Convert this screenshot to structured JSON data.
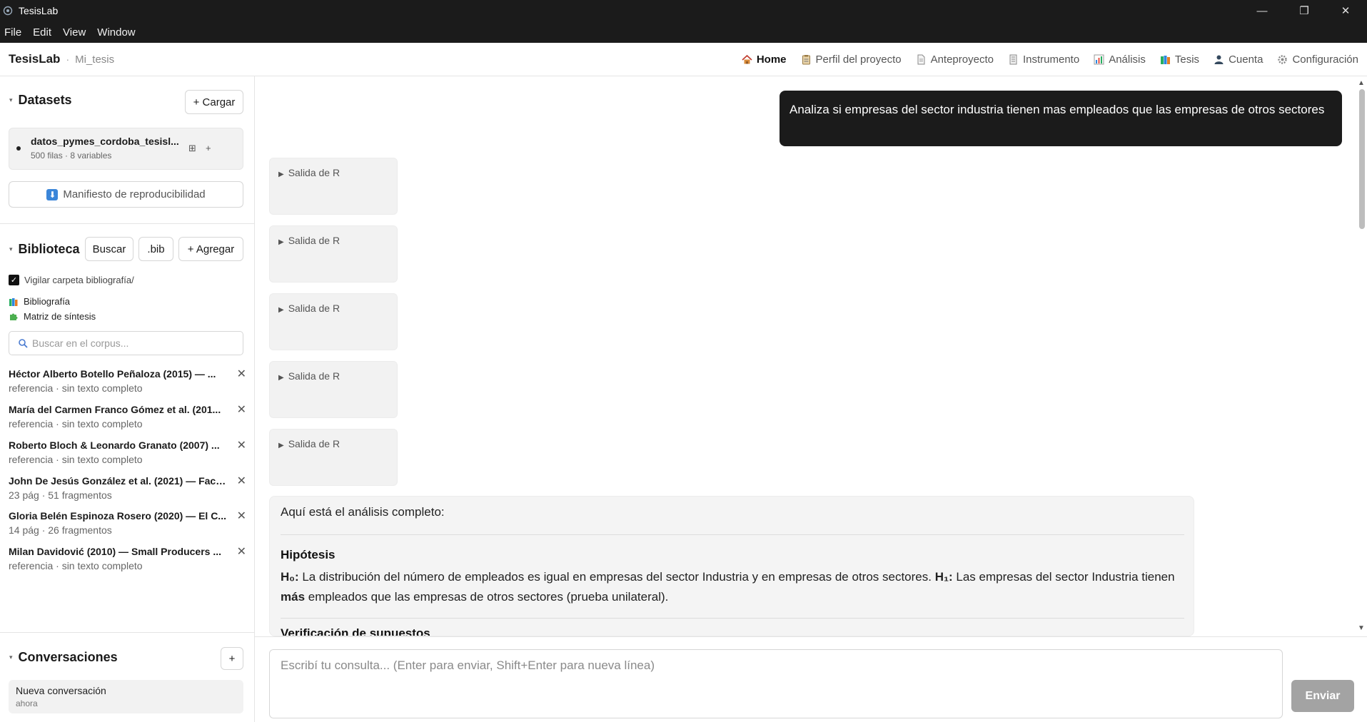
{
  "window": {
    "title": "TesisLab",
    "controls": {
      "minimize": "—",
      "maximize": "❐",
      "close": "✕"
    }
  },
  "menubar": {
    "items": [
      "File",
      "Edit",
      "View",
      "Window"
    ]
  },
  "header": {
    "brand": "TesisLab",
    "separator": "·",
    "project": "Mi_tesis",
    "nav": [
      {
        "label": "Home",
        "icon": "house-icon",
        "active": true
      },
      {
        "label": "Perfil del proyecto",
        "icon": "clipboard-icon"
      },
      {
        "label": "Anteproyecto",
        "icon": "document-icon"
      },
      {
        "label": "Instrumento",
        "icon": "list-icon"
      },
      {
        "label": "Análisis",
        "icon": "bar-chart-icon"
      },
      {
        "label": "Tesis",
        "icon": "books-icon"
      },
      {
        "label": "Cuenta",
        "icon": "user-icon"
      },
      {
        "label": "Configuración",
        "icon": "gear-icon"
      }
    ]
  },
  "sidebar": {
    "datasets": {
      "title": "Datasets",
      "caret": "▾",
      "load_button": "+ Cargar",
      "item": {
        "name": "datos_pymes_cordoba_tesisl...",
        "meta": "500 filas · 8 variables",
        "icon1": "⊞",
        "icon2": "+"
      },
      "manifest_button": "Manifiesto de reproducibilidad",
      "manifest_icon": "⬇"
    },
    "biblioteca": {
      "title": "Biblioteca",
      "caret": "▾",
      "buttons": {
        "search": "Buscar",
        "bib": ".bib",
        "add": "+ Agregar"
      },
      "watch_checkbox": {
        "label": "Vigilar carpeta bibliografía/",
        "checked": true
      },
      "links": [
        {
          "label": "Bibliografía",
          "icon": "books-icon"
        },
        {
          "label": "Matriz de síntesis",
          "icon": "puzzle-icon"
        }
      ],
      "search_placeholder": "Buscar en el corpus...",
      "references": [
        {
          "title": "Héctor Alberto Botello Peñaloza (2015) — ...",
          "meta": "referencia · sin texto completo"
        },
        {
          "title": "María del Carmen Franco Gómez et al. (201...",
          "meta": "referencia · sin texto completo"
        },
        {
          "title": "Roberto Bloch & Leonardo Granato (2007) ...",
          "meta": "referencia · sin texto completo"
        },
        {
          "title": "John De Jesús González et al. (2021) — Fact...",
          "meta": "23 pág · 51 fragmentos"
        },
        {
          "title": "Gloria Belén Espinoza Rosero (2020) — El C...",
          "meta": "14 pág · 26 fragmentos"
        },
        {
          "title": "Milan Davidović (2010) — Small Producers ...",
          "meta": "referencia · sin texto completo"
        }
      ]
    },
    "conversaciones": {
      "title": "Conversaciones",
      "caret": "▾",
      "add_button": "+",
      "items": [
        {
          "title": "Nueva conversación",
          "time": "ahora"
        }
      ]
    }
  },
  "chat": {
    "user_message": "Analiza si empresas del sector industria tienen mas empleados que las empresas de otros sectores",
    "r_outputs": [
      "Salida de R",
      "Salida de R",
      "Salida de R",
      "Salida de R",
      "Salida de R"
    ],
    "r_arrow": "▶",
    "answer": {
      "intro": "Aquí está el análisis completo:",
      "heading": "Hipótesis",
      "h0_label": "H₀:",
      "h0_text": " La distribución del número de empleados es igual en empresas del sector Industria y en empresas de otros sectores. ",
      "h1_label": "H₁:",
      "h1_text_a": " Las empresas del sector Industria tienen ",
      "h1_bold": "más",
      "h1_text_b": " empleados que las empresas de otros sectores (prueba unilateral).",
      "next_heading": "Verificación de supuestos"
    }
  },
  "composer": {
    "placeholder": "Escribí tu consulta... (Enter para enviar, Shift+Enter para nueva línea)",
    "send": "Enviar"
  }
}
